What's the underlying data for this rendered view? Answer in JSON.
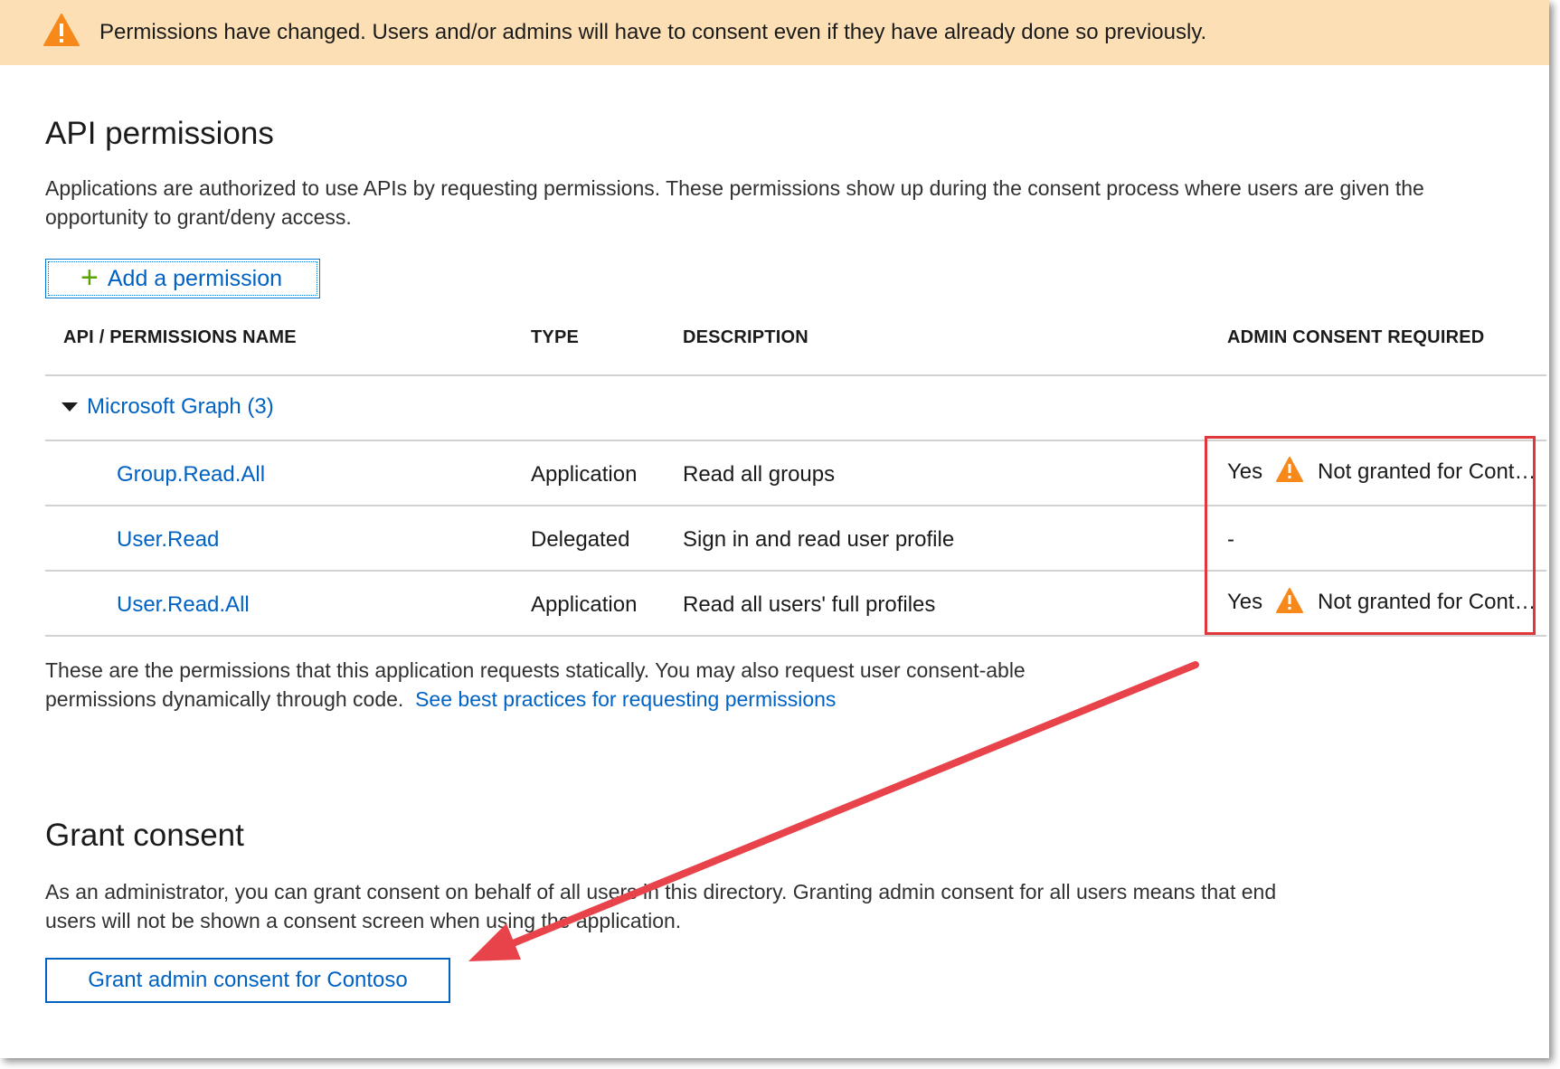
{
  "banner": {
    "text": "Permissions have changed. Users and/or admins will have to consent even if they have already done so previously.",
    "icon": "warning-icon"
  },
  "api_permissions": {
    "title": "API permissions",
    "description": "Applications are authorized to use APIs by requesting permissions. These permissions show up during the consent process where users are given the opportunity to grant/deny access.",
    "add_button": "Add a permission"
  },
  "table": {
    "headers": {
      "name": "API / PERMISSIONS NAME",
      "type": "TYPE",
      "description": "DESCRIPTION",
      "admin": "ADMIN CONSENT REQUIRED"
    },
    "group": "Microsoft Graph (3)",
    "rows": [
      {
        "name": "Group.Read.All",
        "type": "Application",
        "description": "Read all groups",
        "admin": "Yes",
        "status": "Not granted for Cont…"
      },
      {
        "name": "User.Read",
        "type": "Delegated",
        "description": "Sign in and read user profile",
        "admin": "-",
        "status": ""
      },
      {
        "name": "User.Read.All",
        "type": "Application",
        "description": "Read all users' full profiles",
        "admin": "Yes",
        "status": "Not granted for Cont…"
      }
    ]
  },
  "static_note": {
    "text": "These are the permissions that this application requests statically. You may also request user consent-able permissions dynamically through code.",
    "link": "See best practices for requesting permissions"
  },
  "grant_consent": {
    "title": "Grant consent",
    "description": "As an administrator, you can grant consent on behalf of all users in this directory. Granting admin consent for all users means that end users will not be shown a consent screen when using the application.",
    "button": "Grant admin consent for Contoso"
  },
  "colors": {
    "banner_bg": "#fcdfb5",
    "link": "#0062c3",
    "warning": "#f7891b",
    "annotation": "#e0373d"
  }
}
